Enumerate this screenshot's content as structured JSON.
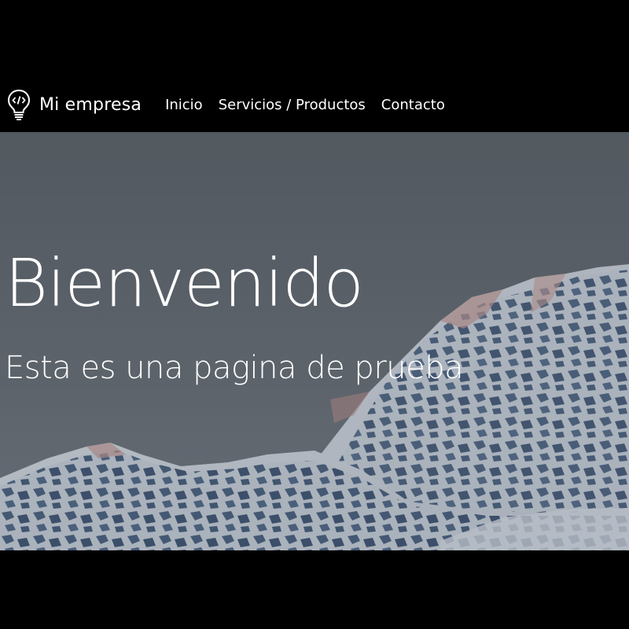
{
  "navbar": {
    "brand_icon": "lightbulb-code-icon",
    "brand_name": "Mi empresa",
    "links": [
      {
        "label": "Inicio"
      },
      {
        "label": "Servicios / Productos"
      },
      {
        "label": "Contacto"
      }
    ]
  },
  "hero": {
    "title": "Bienvenido",
    "subtitle": "Esta es una pagina de prueba",
    "background_image": "snowy-mountain-landscape"
  },
  "colors": {
    "page_background": "#000000",
    "navbar_background": "#000000",
    "text": "#ffffff",
    "sky": "#62676d",
    "snow": "#dfe3e8",
    "rock": "#3d5373"
  }
}
